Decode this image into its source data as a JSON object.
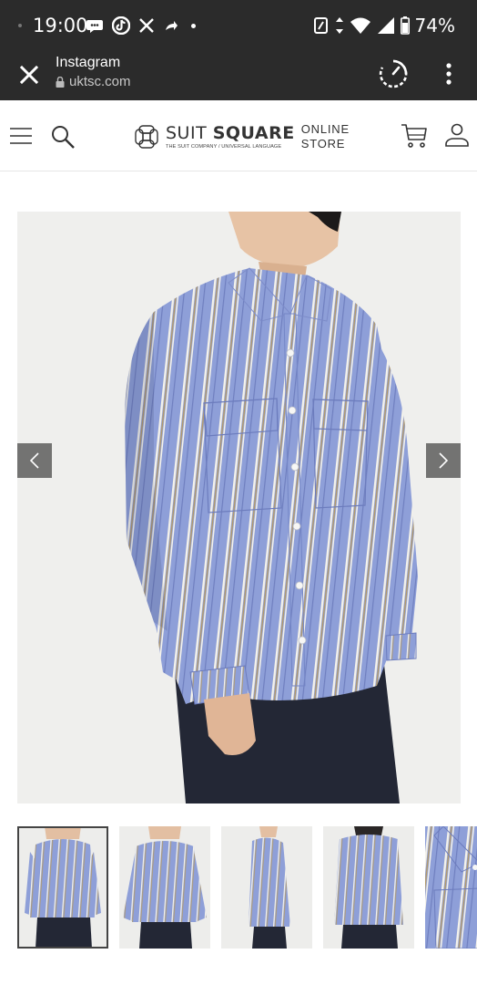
{
  "status_bar": {
    "time": "19:00",
    "battery": "74%",
    "left_icons": [
      "notification-dot-icon",
      "chat-bubble-icon",
      "tiktok-icon",
      "x-logo-icon",
      "share-icon",
      "more-dot-icon"
    ],
    "right_icons": [
      "nfc-icon",
      "data-arrows-icon",
      "wifi-icon",
      "signal-icon",
      "battery-icon"
    ]
  },
  "browser_bar": {
    "title": "Instagram",
    "url": "uktsc.com",
    "icons": [
      "close-icon",
      "lock-icon",
      "timer-icon",
      "more-vertical-icon"
    ]
  },
  "site_header": {
    "brand_light": "SUIT ",
    "brand_bold": "SQUARE",
    "tagline": "THE SUIT COMPANY / UNIVERSAL LANGUAGE",
    "store_line1": "ONLINE",
    "store_line2": "STORE",
    "icons": [
      "hamburger-menu-icon",
      "search-icon",
      "logo-icon",
      "cart-icon",
      "user-icon"
    ]
  },
  "product": {
    "main_image": "striped-shirt-front-view",
    "nav_icons": [
      "chevron-left-icon",
      "chevron-right-icon"
    ],
    "colors": {
      "shirt": "#8e9fd8",
      "stripe_white": "#f4f2ea",
      "stripe_tan": "#b49a66",
      "pants": "#232735",
      "skin": "#e7c3a5",
      "hair": "#1c1a1a"
    },
    "thumbnails": [
      {
        "view": "front-full",
        "selected": true
      },
      {
        "view": "front-open-arms",
        "selected": false
      },
      {
        "view": "side",
        "selected": false
      },
      {
        "view": "back",
        "selected": false
      },
      {
        "view": "detail-closeup",
        "selected": false
      }
    ]
  }
}
